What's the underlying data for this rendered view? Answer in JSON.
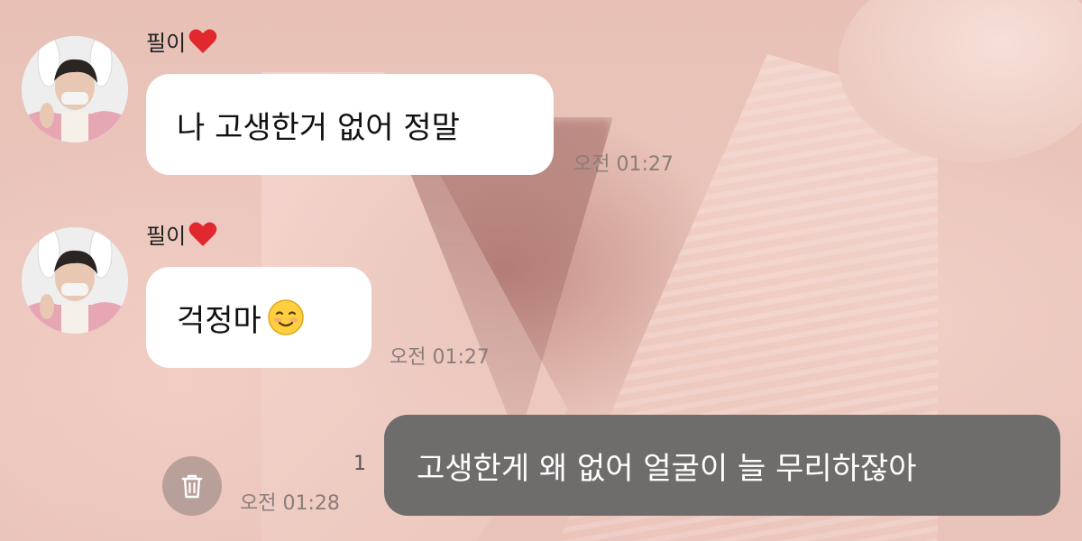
{
  "chat": {
    "messages": [
      {
        "sender": "필이",
        "sender_badge": "heart-icon",
        "text": "나 고생한거 없어 정말",
        "time": "오전 01:27"
      },
      {
        "sender": "필이",
        "sender_badge": "heart-icon",
        "text": "걱정마",
        "emoji": "smiling-face-icon",
        "time": "오전 01:27"
      }
    ],
    "my_message": {
      "text": "고생한게 왜 없어 얼굴이 늘 무리하잖아",
      "unread_count": "1",
      "time": "오전 01:28"
    },
    "actions": {
      "delete_icon": "trash-icon"
    }
  },
  "colors": {
    "incoming_bubble": "#ffffff",
    "outgoing_bubble": "#6f6d6c",
    "heart": "#e0282e",
    "wallpaper_tint": "#e8bfb6"
  }
}
